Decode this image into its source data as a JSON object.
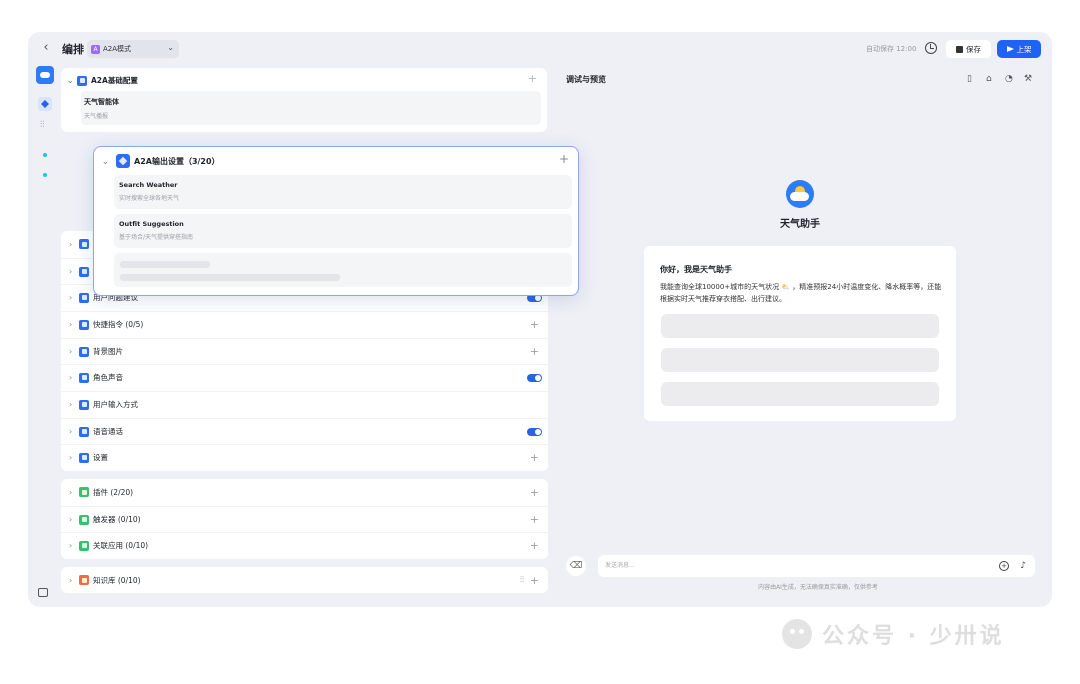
{
  "topbar": {
    "title": "编排",
    "mode_badge": "A",
    "mode_label": "A2A模式",
    "autosave": "自动保存 12:00",
    "save_label": "保存",
    "publish_label": "上架"
  },
  "basic": {
    "title": "A2A基础配置",
    "agent_name": "天气智能体",
    "agent_desc": "天气播报"
  },
  "popup": {
    "title": "A2A输出设置（3/20）",
    "tools": [
      {
        "name": "Search Weather",
        "desc": "实时搜索全球各地天气"
      },
      {
        "name": "Outfit Suggestion",
        "desc": "基于场合/天气提供穿搭指南"
      }
    ]
  },
  "settings": {
    "rows": [
      {
        "label": "用户问题建议"
      },
      {
        "label": "快捷指令 (0/5)"
      },
      {
        "label": "背景图片"
      },
      {
        "label": "角色声音"
      },
      {
        "label": "用户输入方式"
      },
      {
        "label": "语音通话"
      },
      {
        "label": "设置"
      }
    ]
  },
  "plugins": {
    "rows": [
      {
        "label": "插件 (2/20)"
      },
      {
        "label": "触发器 (0/10)"
      },
      {
        "label": "关联应用 (0/10)"
      }
    ]
  },
  "knowledge": {
    "label": "知识库 (0/10)"
  },
  "preview": {
    "title": "调试与预览",
    "bot_name": "天气助手",
    "greeting_title": "你好，我是天气助手",
    "greeting_body": "我能查询全球10000+城市的天气状况 ⛅ ，精准预报24小时温度变化、降水概率等，还能根据实时天气推荐穿衣搭配、出行建议。",
    "input_placeholder": "发送消息...",
    "disclaimer": "内容由AI生成，无法确保真实准确，仅供参考"
  },
  "watermark": {
    "text": "公众号 · 少卅说"
  }
}
